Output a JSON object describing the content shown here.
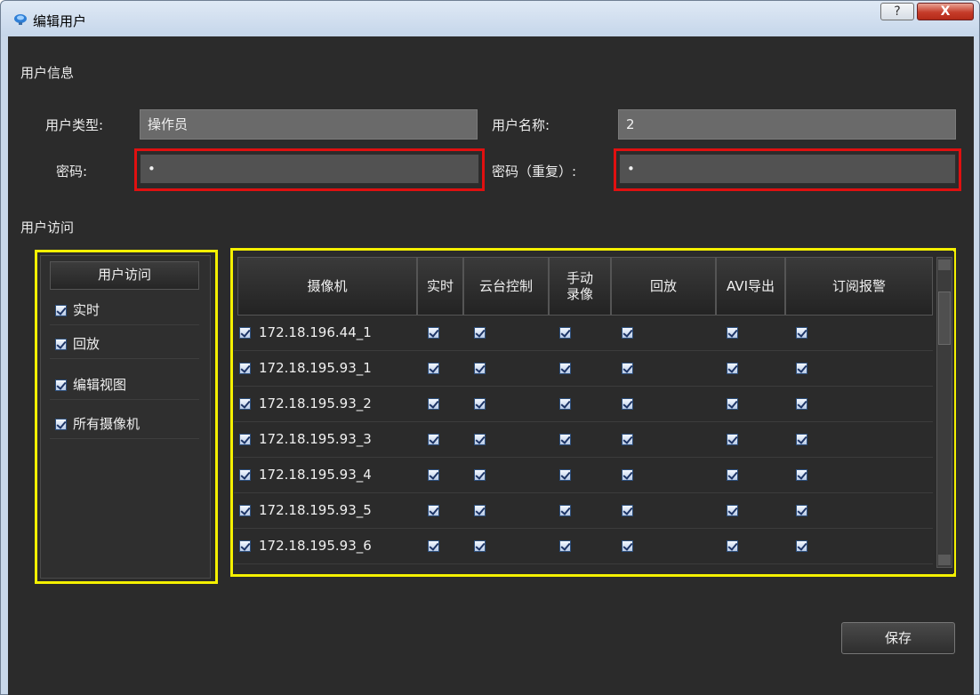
{
  "window": {
    "title": "编辑用户",
    "help_label": "?",
    "close_label": "X"
  },
  "user_info": {
    "section_title": "用户信息",
    "type_label": "用户类型:",
    "type_value": "操作员",
    "name_label": "用户名称:",
    "name_value": "2",
    "password_label": "密码:",
    "password_value": "•",
    "password_repeat_label": "密码（重复）:",
    "password_repeat_value": "•"
  },
  "access": {
    "section_title": "用户访问",
    "header": "用户访问",
    "items": [
      {
        "label": "实时",
        "checked": true
      },
      {
        "label": "回放",
        "checked": true
      },
      {
        "label": "编辑视图",
        "checked": true
      },
      {
        "label": "所有摄像机",
        "checked": true
      }
    ]
  },
  "cameras": {
    "columns": [
      "摄像机",
      "实时",
      "云台控制",
      "手动\n录像",
      "回放",
      "AVI导出",
      "订阅报警"
    ],
    "rows": [
      {
        "name": "172.18.196.44_1"
      },
      {
        "name": "172.18.195.93_1"
      },
      {
        "name": "172.18.195.93_2"
      },
      {
        "name": "172.18.195.93_3"
      },
      {
        "name": "172.18.195.93_4"
      },
      {
        "name": "172.18.195.93_5"
      },
      {
        "name": "172.18.195.93_6"
      }
    ]
  },
  "footer": {
    "save_label": "保存"
  },
  "colors": {
    "highlight_red": "#e01010",
    "highlight_yellow": "#f4f000"
  }
}
